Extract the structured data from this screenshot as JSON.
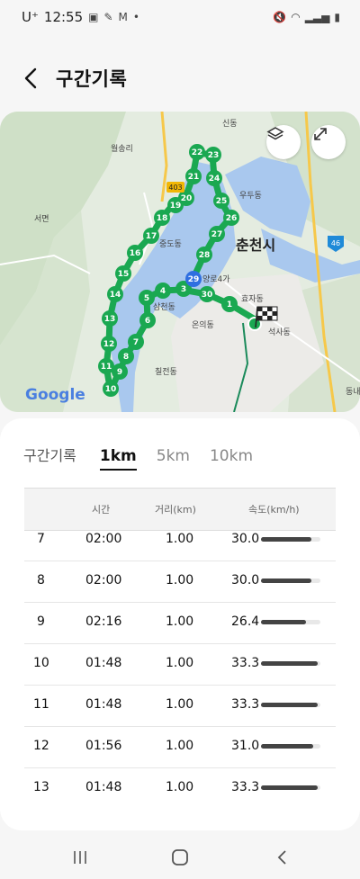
{
  "status": {
    "carrier": "U⁺",
    "time": "12:55"
  },
  "header": {
    "title": "구간기록"
  },
  "map": {
    "places": [
      "신동",
      "월송리",
      "우두동",
      "서면",
      "중도동",
      "춘천시",
      "효자동",
      "석사동",
      "삼천동",
      "온의동",
      "칠전동",
      "동내",
      "양로4가"
    ],
    "road_badge": "403",
    "highway_badge": "46",
    "google": "Google",
    "km_markers": [
      "1",
      "2",
      "3",
      "4",
      "5",
      "6",
      "7",
      "8",
      "9",
      "10",
      "11",
      "12",
      "13",
      "14",
      "15",
      "16",
      "17",
      "18",
      "19",
      "20",
      "21",
      "22",
      "23",
      "24",
      "25",
      "26",
      "27",
      "28",
      "29",
      "30"
    ]
  },
  "tabs": {
    "label": "구간기록",
    "items": [
      "1km",
      "5km",
      "10km"
    ],
    "active": "1km"
  },
  "table": {
    "headers": {
      "time": "시간",
      "distance": "거리(km)",
      "speed": "속도(km/h)"
    },
    "rows": [
      {
        "no": "7",
        "time": "02:00",
        "dist": "1.00",
        "speed": "30.0"
      },
      {
        "no": "8",
        "time": "02:00",
        "dist": "1.00",
        "speed": "30.0"
      },
      {
        "no": "9",
        "time": "02:16",
        "dist": "1.00",
        "speed": "26.4"
      },
      {
        "no": "10",
        "time": "01:48",
        "dist": "1.00",
        "speed": "33.3"
      },
      {
        "no": "11",
        "time": "01:48",
        "dist": "1.00",
        "speed": "33.3"
      },
      {
        "no": "12",
        "time": "01:56",
        "dist": "1.00",
        "speed": "31.0"
      },
      {
        "no": "13",
        "time": "01:48",
        "dist": "1.00",
        "speed": "33.3"
      }
    ]
  },
  "colors": {
    "route": "#1aa851",
    "accent_marker": "#2f6fe0",
    "water": "#a9c8ee"
  }
}
